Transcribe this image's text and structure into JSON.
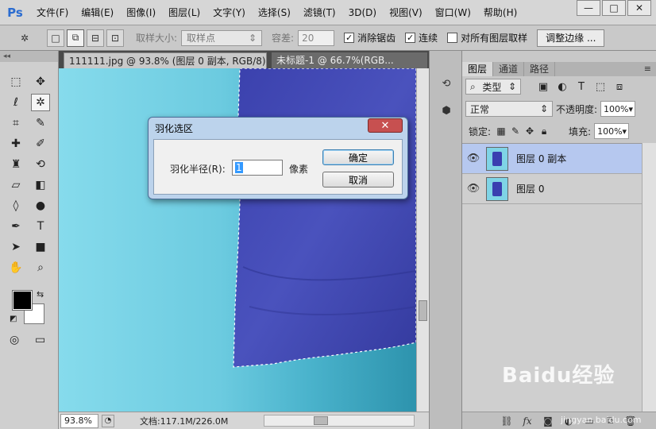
{
  "app": {
    "logo": "Ps"
  },
  "menu": [
    "文件(F)",
    "编辑(E)",
    "图像(I)",
    "图层(L)",
    "文字(Y)",
    "选择(S)",
    "滤镜(T)",
    "3D(D)",
    "视图(V)",
    "窗口(W)",
    "帮助(H)"
  ],
  "window_controls": {
    "minimize": "—",
    "maximize": "□",
    "close": "✕"
  },
  "options": {
    "sample_size_label": "取样大小:",
    "sample_size_value": "取样点",
    "tolerance_label": "容差:",
    "tolerance_value": "20",
    "anti_alias_label": "消除锯齿",
    "anti_alias_checked": true,
    "contiguous_label": "连续",
    "contiguous_checked": true,
    "sample_all_label": "对所有图层取样",
    "sample_all_checked": false,
    "refine_edge_label": "调整边缘 ..."
  },
  "tabs": [
    {
      "label": "111111.jpg @ 93.8% (图层 0 副本, RGB/8) *",
      "active": true
    },
    {
      "label": "未标题-1 @ 66.7%(RGB...",
      "active": false
    }
  ],
  "status": {
    "zoom": "93.8%",
    "doc_info": "文档:117.1M/226.0M"
  },
  "layers_panel": {
    "tabs": [
      "图层",
      "通道",
      "路径"
    ],
    "filter_label": "类型",
    "blend_mode": "正常",
    "opacity_label": "不透明度:",
    "opacity_value": "100%",
    "lock_label": "锁定:",
    "fill_label": "填充:",
    "fill_value": "100%",
    "layers": [
      {
        "name": "图层 0 副本",
        "selected": true
      },
      {
        "name": "图层 0",
        "selected": false
      }
    ],
    "footer_icons": [
      "link-icon",
      "fx-icon",
      "mask-icon",
      "adjustment-icon",
      "group-icon",
      "new-layer-icon",
      "trash-icon"
    ]
  },
  "dialog": {
    "title": "羽化选区",
    "radius_label": "羽化半径(R):",
    "radius_value": "1",
    "unit": "像素",
    "ok_label": "确定",
    "cancel_label": "取消",
    "close_glyph": "✕"
  },
  "watermark": {
    "brand": "Baidu经验",
    "url": "jingyan.baidu.com"
  },
  "colors": {
    "canvas_bg": "#7fd4e6",
    "cloth": "#3a3fb0",
    "selected_layer": "#b6c8ef",
    "foreground": "#000000",
    "background": "#ffffff"
  }
}
